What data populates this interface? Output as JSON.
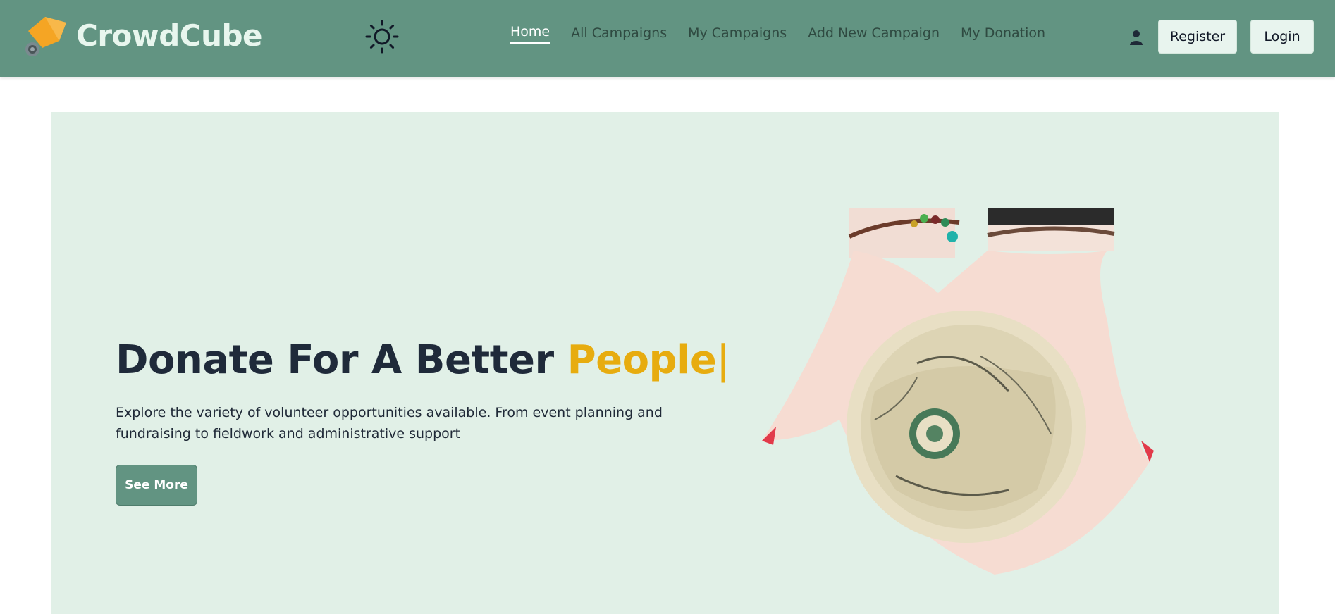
{
  "brand": {
    "name": "CrowdCube",
    "logo_icon": "price-tag-icon",
    "logo_color": "#f5a524"
  },
  "nav": {
    "theme_icon": "sun-icon",
    "links": [
      {
        "label": "Home",
        "active": true
      },
      {
        "label": "All Campaigns",
        "active": false
      },
      {
        "label": "My Campaigns",
        "active": false
      },
      {
        "label": "Add New Campaign",
        "active": false
      },
      {
        "label": "My Donation",
        "active": false
      }
    ],
    "user_icon": "user-icon",
    "register_label": "Register",
    "login_label": "Login"
  },
  "hero": {
    "title_main": "Donate For A Better ",
    "title_accent": "People",
    "caret": "|",
    "description": "Explore the variety of volunteer opportunities available. From event planning and fundraising to fieldwork and administrative support",
    "cta_label": "See More",
    "image": "hands-holding-crumpled-money-illustration"
  },
  "colors": {
    "navbar_bg": "#629482",
    "hero_bg": "#e1f0e7",
    "accent": "#e7ac0f",
    "button_bg": "#629482",
    "title_color": "#1f2a3a"
  }
}
